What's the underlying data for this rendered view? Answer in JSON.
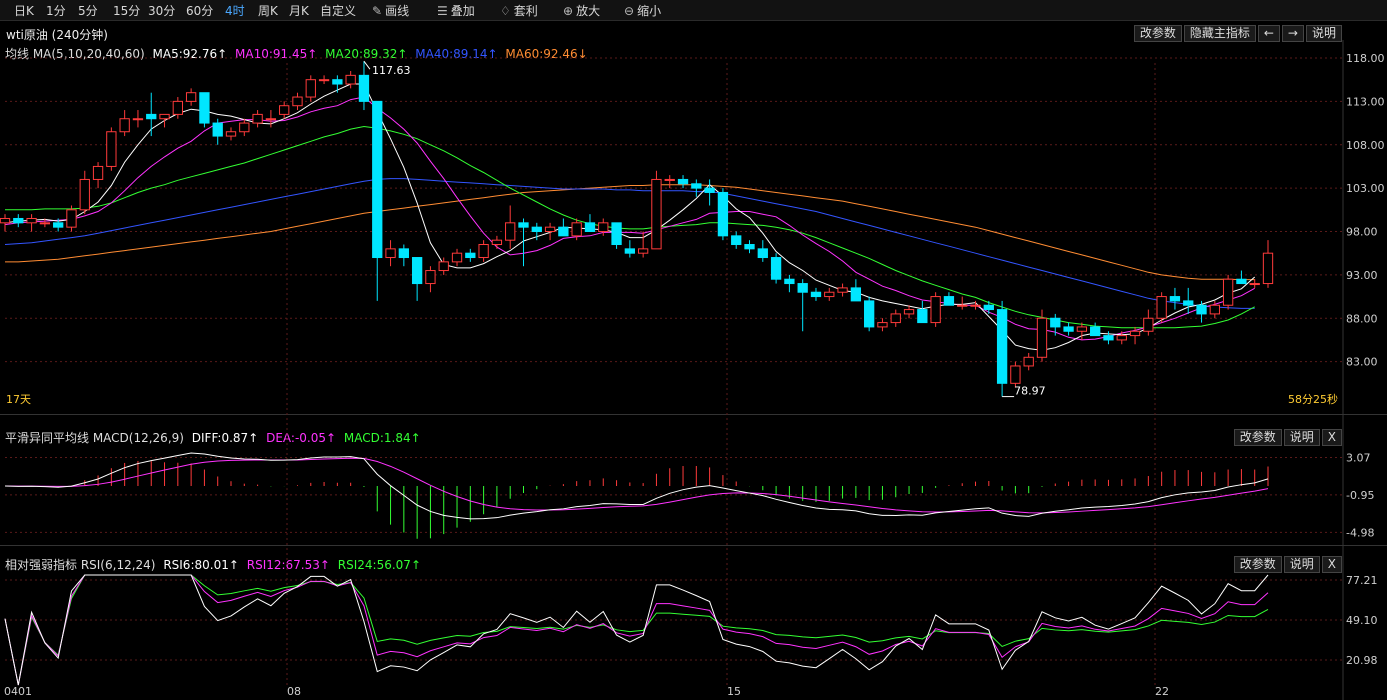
{
  "toolbar": {
    "items": [
      "日K",
      "1分",
      "5分",
      "15分",
      "30分",
      "60分",
      "4时",
      "周K",
      "月K",
      "自定义",
      "画线",
      "叠加",
      "套利",
      "放大",
      "缩小"
    ],
    "active": "4时",
    "icons": {
      "画线": "pencil-icon",
      "叠加": "stack-icon",
      "套利": "arbitrage-icon",
      "放大": "zoom-in-icon",
      "缩小": "zoom-out-icon"
    }
  },
  "chart_title": "wti原油 (240分钟)",
  "main_buttons": [
    "改参数",
    "隐藏主指标"
  ],
  "nav_buttons": {
    "left": "←",
    "right": "→"
  },
  "explain_label": "说明",
  "indicator_buttons": [
    "改参数",
    "说明",
    "X"
  ],
  "colors": {
    "up": "#ff3b3b",
    "down": "#00e6ff",
    "ma5": "#ffffff",
    "ma10": "#ff33ff",
    "ma20": "#33ff33",
    "ma40": "#3355ff",
    "ma60": "#ff8c33",
    "grid": "#5a1a1a",
    "bg": "#000000",
    "timer": "#ffcc33"
  },
  "ma_legend": {
    "prefix": "均线 MA(5,10,20,40,60)",
    "ma5": "MA5:92.76↑",
    "ma10": "MA10:91.45↑",
    "ma20": "MA20:89.32↑",
    "ma40": "MA40:89.14↑",
    "ma60": "MA60:92.46↓"
  },
  "main_axis": [
    "118.00",
    "113.00",
    "108.00",
    "103.00",
    "98.00",
    "93.00",
    "88.00",
    "83.00"
  ],
  "high_label": "117.63",
  "low_label": "78.97",
  "days_label": "17天",
  "countdown": "58分25秒",
  "macd_legend": {
    "prefix": "平滑异同平均线 MACD(12,26,9)",
    "diff": "DIFF:0.87↑",
    "dea": "DEA:-0.05↑",
    "macd": "MACD:1.84↑"
  },
  "macd_axis": [
    "3.07",
    "-0.95",
    "-4.98"
  ],
  "rsi_legend": {
    "prefix": "相对强弱指标 RSI(6,12,24)",
    "rsi6": "RSI6:80.01↑",
    "rsi12": "RSI12:67.53↑",
    "rsi24": "RSI24:56.07↑"
  },
  "rsi_axis": [
    "77.21",
    "49.10",
    "20.98"
  ],
  "date_labels": [
    "0401",
    "08",
    "15",
    "22"
  ],
  "chart_data": {
    "type": "candlestick",
    "title": "wti原油 (240分钟)",
    "ylim": [
      78,
      119
    ],
    "candles": [
      [
        99,
        100,
        98,
        99.5
      ],
      [
        99.5,
        100,
        98.5,
        99
      ],
      [
        99,
        100,
        98,
        99.5
      ],
      [
        99,
        99.5,
        98.5,
        99
      ],
      [
        99,
        99.5,
        98,
        98.5
      ],
      [
        98.5,
        101,
        98,
        100.5
      ],
      [
        100.5,
        105,
        100,
        104
      ],
      [
        104,
        106,
        103,
        105.5
      ],
      [
        105.5,
        110,
        105,
        109.5
      ],
      [
        109.5,
        112,
        109,
        111
      ],
      [
        111,
        112,
        110,
        111
      ],
      [
        111.5,
        114,
        109,
        111
      ],
      [
        111,
        111.5,
        110,
        111.5
      ],
      [
        111.5,
        113.5,
        111,
        113
      ],
      [
        113,
        114.5,
        112.5,
        114
      ],
      [
        114,
        114,
        110,
        110.5
      ],
      [
        110.5,
        111,
        108,
        109
      ],
      [
        109,
        110,
        108.5,
        109.5
      ],
      [
        109.5,
        111,
        109,
        110.5
      ],
      [
        110.5,
        112,
        110,
        111.5
      ],
      [
        111,
        112,
        110,
        111
      ],
      [
        111.5,
        113,
        111,
        112.5
      ],
      [
        112.5,
        114,
        112,
        113.5
      ],
      [
        113.5,
        116,
        113,
        115.5
      ],
      [
        115.5,
        116,
        115,
        115.5
      ],
      [
        115.5,
        116,
        114,
        115
      ],
      [
        115,
        116.5,
        114.5,
        116
      ],
      [
        116,
        117.63,
        112,
        113
      ],
      [
        113,
        113,
        90,
        95
      ],
      [
        95,
        97,
        94,
        96
      ],
      [
        96,
        96.5,
        94,
        95
      ],
      [
        95,
        95,
        90,
        92
      ],
      [
        92,
        94,
        91,
        93.5
      ],
      [
        93.5,
        95,
        93,
        94.5
      ],
      [
        94.5,
        96,
        94,
        95.5
      ],
      [
        95.5,
        96,
        94.5,
        95
      ],
      [
        95,
        97,
        94.5,
        96.5
      ],
      [
        96.5,
        97.5,
        96,
        97
      ],
      [
        97,
        101,
        96,
        99
      ],
      [
        99,
        99.5,
        94,
        98.5
      ],
      [
        98.5,
        99,
        97,
        98
      ],
      [
        98,
        99,
        97,
        98.5
      ],
      [
        98.5,
        99.5,
        97.5,
        97.5
      ],
      [
        97.5,
        99.5,
        97,
        99
      ],
      [
        99,
        100,
        98,
        98
      ],
      [
        98,
        99.5,
        97.5,
        99
      ],
      [
        99,
        99,
        96,
        96.5
      ],
      [
        96,
        97,
        95,
        95.5
      ],
      [
        95.5,
        98,
        95,
        96
      ],
      [
        96,
        105,
        96,
        104
      ],
      [
        104,
        104.5,
        103,
        104
      ],
      [
        104,
        104.5,
        103,
        103.5
      ],
      [
        103.5,
        104,
        102,
        103
      ],
      [
        103,
        104,
        101,
        102.5
      ],
      [
        102.5,
        103,
        97,
        97.5
      ],
      [
        97.5,
        98,
        96,
        96.5
      ],
      [
        96.5,
        97,
        95.5,
        96
      ],
      [
        96,
        97,
        94.5,
        95
      ],
      [
        95,
        95.5,
        92,
        92.5
      ],
      [
        92.5,
        93,
        91,
        92
      ],
      [
        92,
        92.5,
        86.5,
        91
      ],
      [
        91,
        91.5,
        90,
        90.5
      ],
      [
        90.5,
        91.5,
        90,
        91
      ],
      [
        91,
        92,
        90.5,
        91.5
      ],
      [
        91.5,
        92.5,
        91,
        90
      ],
      [
        90,
        90.5,
        86.5,
        87
      ],
      [
        87,
        88,
        86.5,
        87.5
      ],
      [
        87.5,
        89,
        87,
        88.5
      ],
      [
        88.5,
        89.5,
        88,
        89
      ],
      [
        89,
        90,
        88,
        87.5
      ],
      [
        87.5,
        91,
        87,
        90.5
      ],
      [
        90.5,
        91,
        89.5,
        89.5
      ],
      [
        89.5,
        90.5,
        89,
        89.5
      ],
      [
        89.5,
        90,
        89,
        89.5
      ],
      [
        89.5,
        90,
        88.5,
        89
      ],
      [
        89,
        90,
        78.97,
        80.5
      ],
      [
        80.5,
        83,
        80,
        82.5
      ],
      [
        82.5,
        84,
        82,
        83.5
      ],
      [
        83.5,
        89,
        83,
        88
      ],
      [
        88,
        88.5,
        86,
        87
      ],
      [
        87,
        87.5,
        86,
        86.5
      ],
      [
        86.5,
        87.5,
        85.5,
        87
      ],
      [
        87,
        87.5,
        86,
        86
      ],
      [
        86,
        86.5,
        85,
        85.5
      ],
      [
        85.5,
        86.5,
        85,
        86
      ],
      [
        86,
        87,
        85,
        86.5
      ],
      [
        86.5,
        89,
        86,
        88
      ],
      [
        88,
        91,
        87.5,
        90.5
      ],
      [
        90.5,
        91.5,
        89,
        90
      ],
      [
        90,
        91.5,
        88.5,
        89.5
      ],
      [
        89.5,
        90,
        87.5,
        88.5
      ],
      [
        88.5,
        90,
        88,
        89.5
      ],
      [
        89.5,
        93,
        89,
        92.5
      ],
      [
        92.5,
        93.5,
        92,
        92
      ],
      [
        92,
        92.5,
        91.5,
        92
      ],
      [
        92,
        97,
        91.5,
        95.5
      ]
    ],
    "ma5": [
      99,
      99.2,
      99.3,
      99.4,
      99.2,
      99.4,
      100.3,
      101.4,
      103.3,
      106,
      108,
      109.8,
      110.8,
      111.6,
      112.1,
      111.9,
      111.5,
      111.3,
      110.9,
      110.5,
      110.4,
      111,
      111.7,
      112.7,
      113.6,
      114.3,
      115,
      115,
      111.8,
      108.7,
      105.4,
      101.3,
      96.7,
      94.2,
      93.8,
      93.8,
      94.3,
      95.1,
      95.8,
      96.9,
      97.4,
      97.9,
      98.5,
      98.4,
      98.3,
      98.2,
      97.9,
      97.3,
      97.3,
      98.2,
      99.3,
      100.5,
      101.8,
      103.4,
      102.1,
      100.6,
      99.6,
      97.8,
      95.7,
      94.4,
      93.5,
      92.4,
      91.8,
      91.2,
      91,
      90.4,
      90,
      89.7,
      89.4,
      89.1,
      89.4,
      89.6,
      89.6,
      89.8,
      88.2,
      86.6,
      84.9,
      84.5,
      84.3,
      84.6,
      85.2,
      86,
      86.3,
      86.2,
      86.1,
      86.2,
      86.9,
      87.8,
      88.6,
      89.3,
      89.6,
      90.1,
      90.9,
      91.4,
      92.76
    ],
    "ma10": [
      98.8,
      99,
      99.1,
      99.2,
      99.3,
      99.4,
      99.8,
      100.3,
      101.3,
      102.7,
      104.2,
      105.5,
      106.6,
      107.6,
      108.4,
      109.6,
      110.5,
      110.7,
      110.9,
      110.9,
      110.7,
      110.8,
      111.2,
      111.8,
      112.2,
      112.5,
      113.2,
      113.5,
      112.2,
      111.1,
      109.8,
      108.2,
      106.1,
      104.1,
      101.9,
      99.8,
      97.8,
      96.2,
      95.3,
      95.5,
      95.8,
      96.4,
      97.2,
      97.4,
      97.5,
      97.9,
      97.9,
      97.9,
      97.8,
      98.2,
      98.6,
      99,
      99.4,
      100.1,
      100.2,
      100.3,
      100.3,
      100,
      99.7,
      98.7,
      97.6,
      96.6,
      95.7,
      94.6,
      93.3,
      92.5,
      91.7,
      91.2,
      90.6,
      90.1,
      89.9,
      89.7,
      89.5,
      89.5,
      88.7,
      88.1,
      87.3,
      86.8,
      86.7,
      86.4,
      85.8,
      85.5,
      85.6,
      85.9,
      86.3,
      86.6,
      87,
      87.5,
      88,
      88.6,
      89.2,
      89.6,
      90.1,
      90.6,
      91.45
    ],
    "ma20": [
      100.5,
      100.5,
      100.5,
      100.6,
      100.6,
      100.6,
      100.7,
      100.9,
      101.3,
      101.9,
      102.5,
      103,
      103.4,
      103.9,
      104.3,
      104.7,
      105.1,
      105.5,
      105.9,
      106.4,
      106.9,
      107.4,
      107.9,
      108.4,
      108.9,
      109.3,
      109.8,
      110.1,
      109.9,
      109.6,
      109.2,
      108.7,
      108,
      107.3,
      106.5,
      105.6,
      104.8,
      103.9,
      103,
      102.2,
      101.4,
      100.6,
      99.9,
      99.3,
      98.9,
      98.6,
      98.4,
      98.3,
      98.3,
      98.5,
      98.6,
      98.7,
      98.8,
      99,
      99,
      98.9,
      98.8,
      98.7,
      98.5,
      98.2,
      97.8,
      97.3,
      96.7,
      96.1,
      95.5,
      94.9,
      94.2,
      93.5,
      92.9,
      92.3,
      91.8,
      91.3,
      90.8,
      90.4,
      89.8,
      89.3,
      88.8,
      88.4,
      88.1,
      87.8,
      87.5,
      87.3,
      87.1,
      87,
      86.9,
      86.9,
      86.9,
      86.9,
      86.9,
      87,
      87.1,
      87.4,
      87.8,
      88.5,
      89.32
    ],
    "ma40": [
      96.5,
      96.6,
      96.7,
      96.9,
      97.1,
      97.3,
      97.5,
      97.8,
      98.1,
      98.4,
      98.7,
      99,
      99.3,
      99.6,
      99.9,
      100.2,
      100.5,
      100.8,
      101.1,
      101.4,
      101.7,
      102,
      102.3,
      102.6,
      102.9,
      103.2,
      103.5,
      103.8,
      104,
      104.1,
      104.1,
      104,
      103.9,
      103.8,
      103.7,
      103.6,
      103.5,
      103.4,
      103.3,
      103.2,
      103.1,
      103,
      102.9,
      102.9,
      102.9,
      102.9,
      102.8,
      102.8,
      102.7,
      102.7,
      102.7,
      102.7,
      102.6,
      102.6,
      102.4,
      102.1,
      101.8,
      101.5,
      101.2,
      100.9,
      100.6,
      100.3,
      99.9,
      99.5,
      99.1,
      98.7,
      98.3,
      97.9,
      97.5,
      97.1,
      96.7,
      96.3,
      95.9,
      95.5,
      95.1,
      94.7,
      94.3,
      93.9,
      93.5,
      93.1,
      92.7,
      92.3,
      91.9,
      91.5,
      91.1,
      90.7,
      90.3,
      90,
      89.8,
      89.6,
      89.4,
      89.3,
      89.2,
      89.14,
      89.14
    ],
    "ma60": [
      94.5,
      94.5,
      94.6,
      94.7,
      94.8,
      95,
      95.2,
      95.4,
      95.6,
      95.8,
      96,
      96.2,
      96.4,
      96.6,
      96.8,
      97,
      97.2,
      97.4,
      97.6,
      97.8,
      98,
      98.3,
      98.6,
      98.9,
      99.2,
      99.5,
      99.8,
      100.1,
      100.3,
      100.5,
      100.7,
      100.9,
      101.1,
      101.3,
      101.5,
      101.7,
      101.9,
      102.1,
      102.3,
      102.5,
      102.6,
      102.7,
      102.8,
      102.9,
      103,
      103.1,
      103.2,
      103.3,
      103.3,
      103.4,
      103.4,
      103.4,
      103.4,
      103.3,
      103.2,
      103.1,
      102.9,
      102.7,
      102.5,
      102.3,
      102.1,
      101.9,
      101.7,
      101.5,
      101.2,
      100.9,
      100.6,
      100.3,
      100,
      99.7,
      99.4,
      99.1,
      98.8,
      98.5,
      98.1,
      97.7,
      97.3,
      96.9,
      96.5,
      96.1,
      95.7,
      95.3,
      94.9,
      94.5,
      94.1,
      93.7,
      93.3,
      93,
      92.8,
      92.6,
      92.5,
      92.5,
      92.5,
      92.46,
      92.46
    ]
  }
}
